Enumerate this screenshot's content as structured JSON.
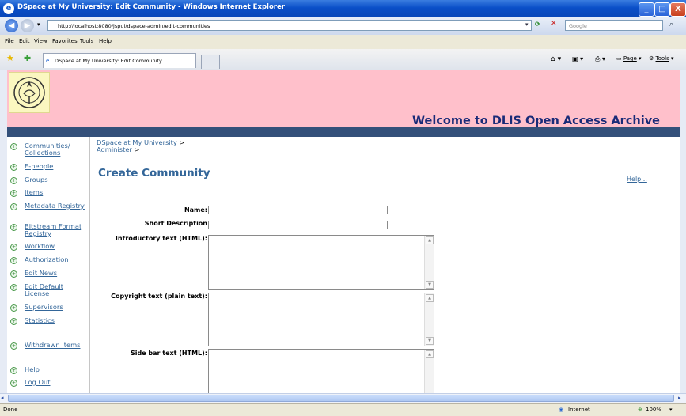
{
  "window": {
    "title": "DSpace at My University: Edit Community - Windows Internet Explorer",
    "minimize": "_",
    "maximize": "□",
    "close": "X"
  },
  "address": {
    "url": "http://localhost:8080/jspui/dspace-admin/edit-communities",
    "search_placeholder": "Google"
  },
  "menu": [
    "File",
    "Edit",
    "View",
    "Favorites",
    "Tools",
    "Help"
  ],
  "tab": {
    "title": "DSpace at My University: Edit Community"
  },
  "commandbar": {
    "page": "Page",
    "tools": "Tools"
  },
  "banner": {
    "welcome": "Welcome to DLIS Open Access Archive"
  },
  "sidebar": {
    "items": [
      {
        "label": "Communities/ Collections"
      },
      {
        "label": "E-people"
      },
      {
        "label": "Groups"
      },
      {
        "label": "Items"
      },
      {
        "label": "Metadata Registry"
      },
      {
        "label": "Bitstream Format Registry"
      },
      {
        "label": "Workflow"
      },
      {
        "label": "Authorization"
      },
      {
        "label": "Edit News"
      },
      {
        "label": "Edit Default License"
      },
      {
        "label": "Supervisors"
      },
      {
        "label": "Statistics"
      },
      {
        "label": "Withdrawn Items"
      },
      {
        "label": "Help"
      },
      {
        "label": "Log Out"
      }
    ]
  },
  "breadcrumb": {
    "home": "DSpace at My University",
    "admin": "Administer",
    "sep": ">"
  },
  "main": {
    "heading": "Create Community",
    "help": "Help...",
    "fields": {
      "name": "Name:",
      "short_description": "Short Description",
      "intro": "Introductory text (HTML):",
      "copyright": "Copyright text (plain text):",
      "sidebar_text": "Side bar text (HTML):"
    }
  },
  "status": {
    "left": "Done",
    "zone": "Internet",
    "zoom": "100%"
  }
}
